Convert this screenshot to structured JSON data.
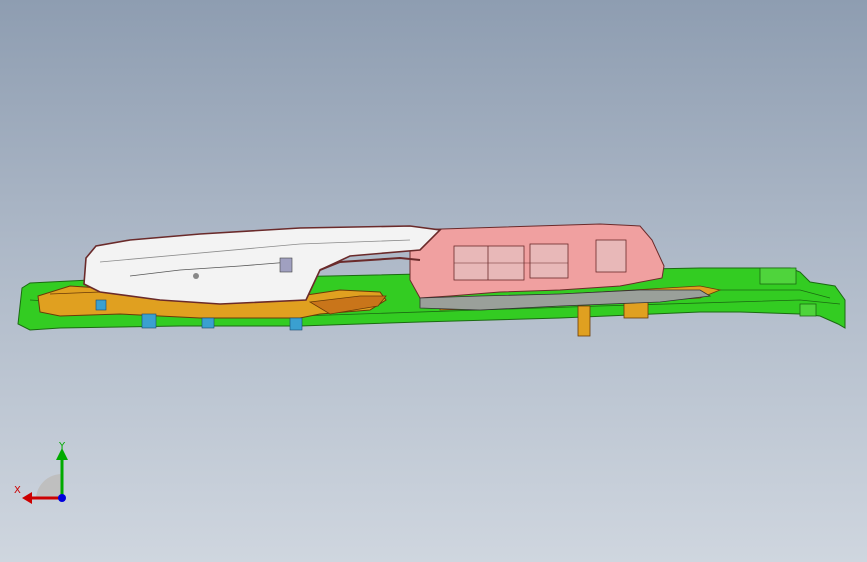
{
  "triad": {
    "x_label": "X",
    "y_label": "Y",
    "colors": {
      "x": "#cc0000",
      "y": "#00aa00",
      "z": "#0000dd"
    }
  },
  "colors": {
    "background_top": "#8e9db1",
    "background_bottom": "#cfd6df",
    "green_part": "#33cc22",
    "orange_part": "#e0a020",
    "pink_part": "#f0a0a0",
    "outline": "#6a2a2a",
    "clip_blue": "#3aa0d0"
  }
}
